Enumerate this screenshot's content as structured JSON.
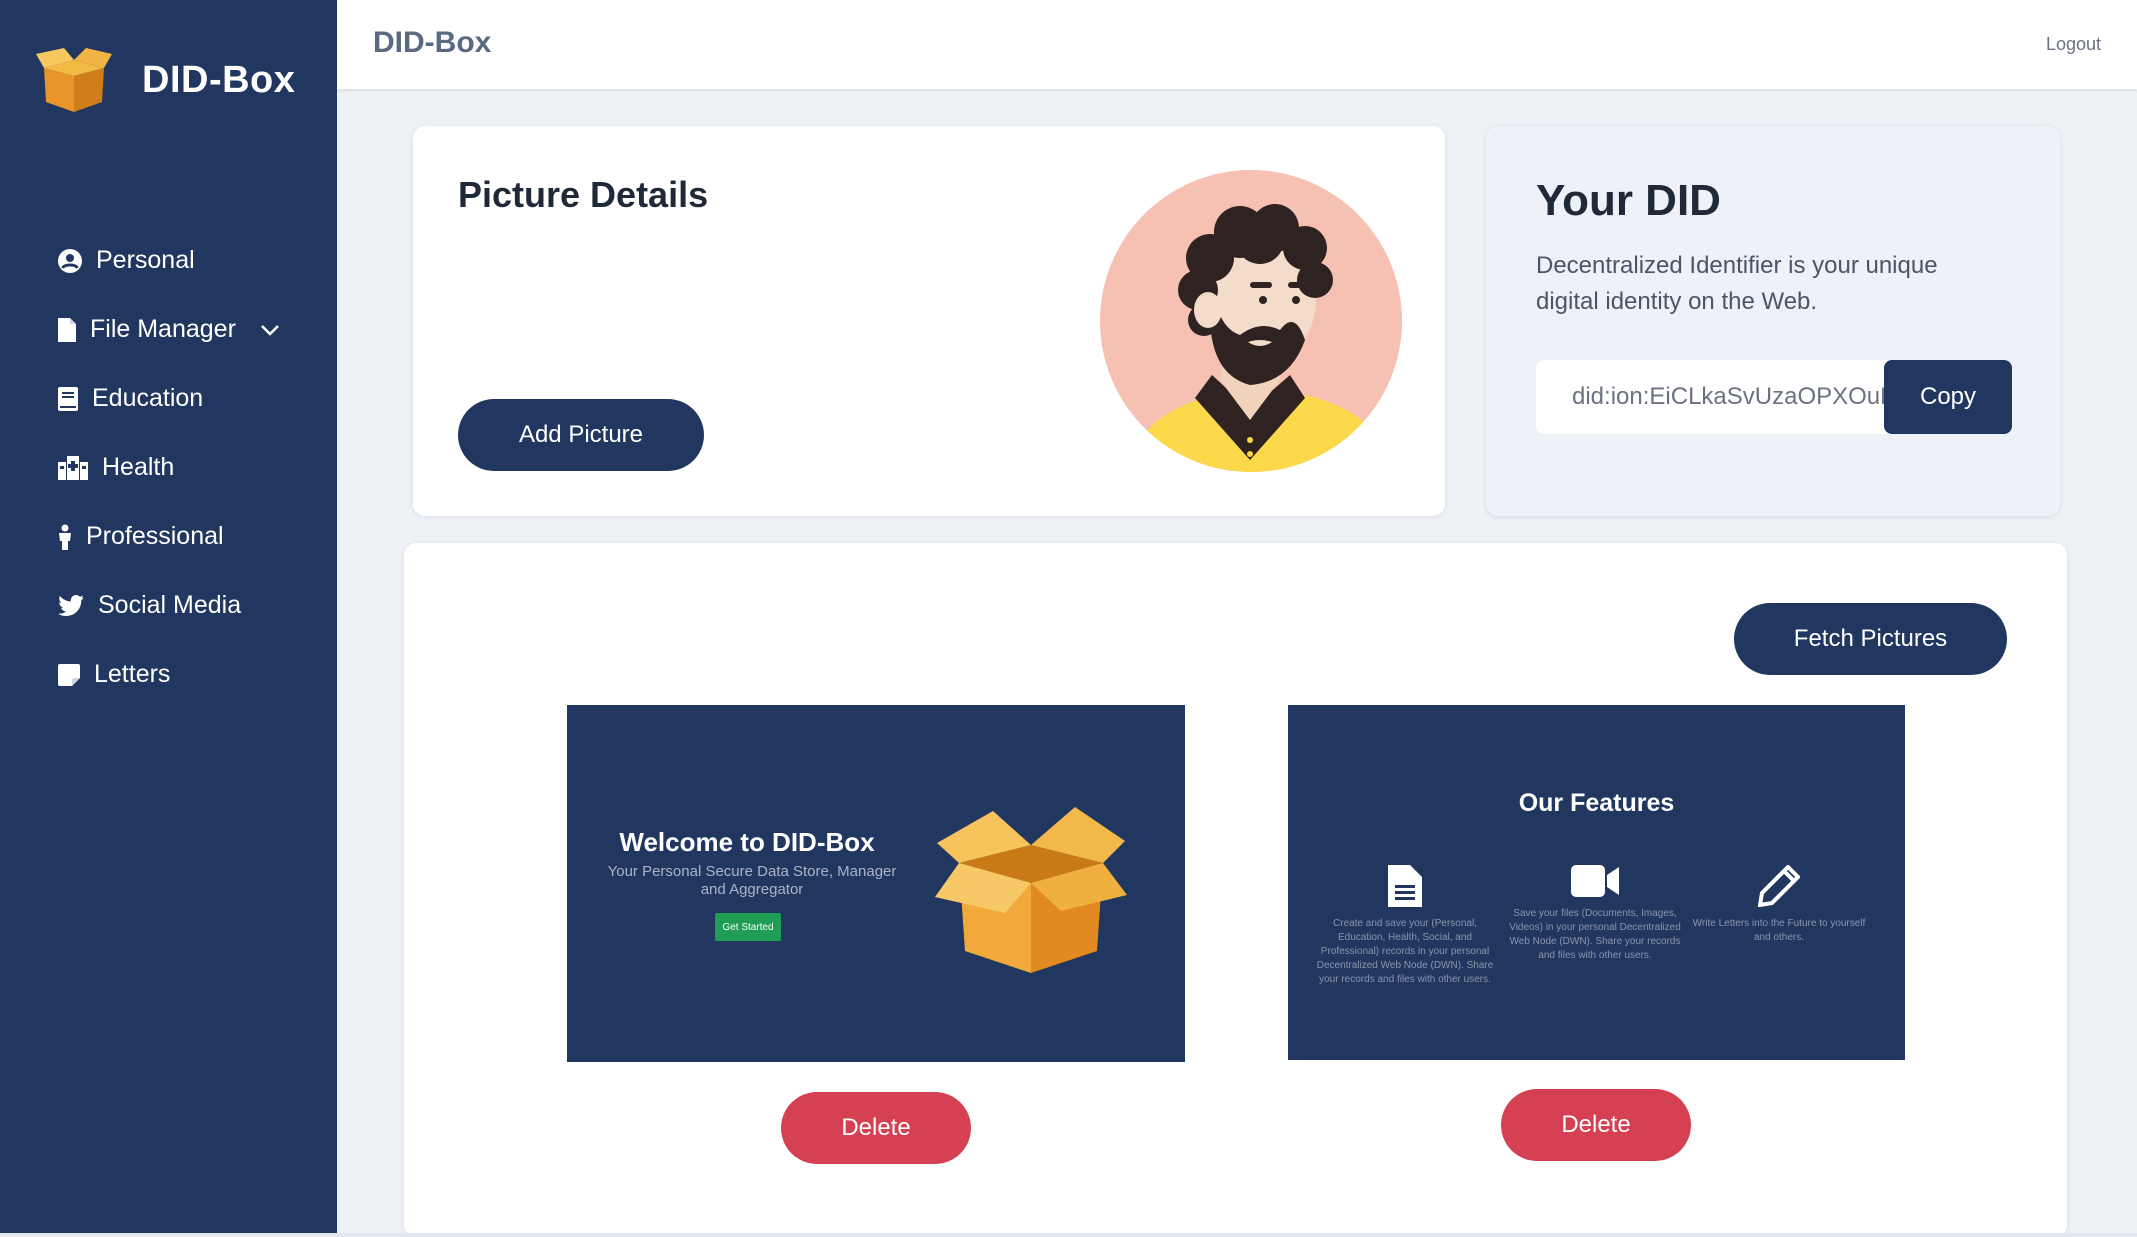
{
  "app": {
    "brand_name": "DID-Box"
  },
  "sidebar": {
    "items": [
      {
        "label": "Personal",
        "icon": "user-circle-icon"
      },
      {
        "label": "File Manager",
        "icon": "file-icon",
        "has_dropdown": true
      },
      {
        "label": "Education",
        "icon": "book-icon"
      },
      {
        "label": "Health",
        "icon": "hospital-icon"
      },
      {
        "label": "Professional",
        "icon": "person-icon"
      },
      {
        "label": "Social Media",
        "icon": "twitter-icon"
      },
      {
        "label": "Letters",
        "icon": "note-icon"
      }
    ]
  },
  "header": {
    "title": "DID-Box",
    "logout_label": "Logout"
  },
  "picture_card": {
    "title": "Picture Details",
    "add_button_label": "Add Picture"
  },
  "did_card": {
    "title": "Your DID",
    "description": "Decentralized Identifier is your unique digital identity on the Web.",
    "did_value": "did:ion:EiCLkaSvUzaOPXOuHz",
    "copy_label": "Copy"
  },
  "gallery": {
    "fetch_label": "Fetch Pictures",
    "pictures": [
      {
        "title": "Welcome to DID-Box",
        "subtitle": "Your Personal Secure Data Store, Manager and Aggregator",
        "button_label": "Get Started",
        "delete_label": "Delete"
      },
      {
        "title": "Our Features",
        "features": [
          {
            "icon": "document-icon",
            "text": "Create and save your (Personal, Education, Health, Social, and Professional) records in your personal Decentralized Web Node (DWN). Share your records and files with other users."
          },
          {
            "icon": "video-icon",
            "text": "Save your files (Documents, Images, Videos) in your personal Decentralized Web Node (DWN). Share your records and files with other users."
          },
          {
            "icon": "pencil-icon",
            "text": "Write Letters into the Future to yourself and others."
          }
        ],
        "delete_label": "Delete"
      }
    ]
  },
  "colors": {
    "sidebar": "#213760",
    "navy_button": "#213760",
    "delete_button": "#d54052",
    "background": "#eef2f7"
  }
}
